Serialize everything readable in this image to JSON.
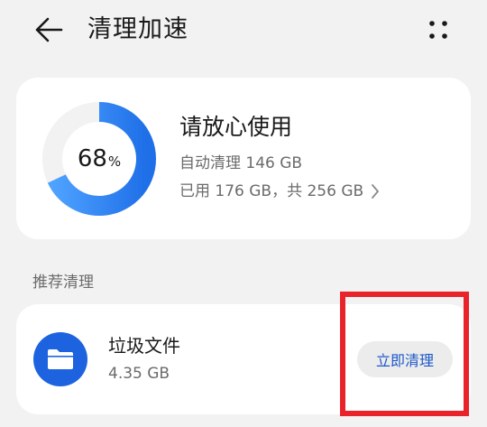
{
  "header": {
    "title": "清理加速",
    "back_icon": "arrow-left-icon",
    "more_icon": "more-dots-icon"
  },
  "storage": {
    "percent": "68",
    "percent_unit": "%",
    "used_fraction": 0.68,
    "headline": "请放心使用",
    "auto_clean": "自动清理 146 GB",
    "used_text": "已用 176 GB，共 256 GB",
    "ring_color": "#2f86f5",
    "ring_track_color": "#f2f2f2"
  },
  "recommend": {
    "section_title": "推荐清理",
    "items": [
      {
        "name": "垃圾文件",
        "size": "4.35 GB",
        "icon": "folder-icon",
        "icon_color": "#1d63e0",
        "action_label": "立即清理"
      }
    ]
  },
  "annotation": {
    "color": "#e8242a"
  }
}
